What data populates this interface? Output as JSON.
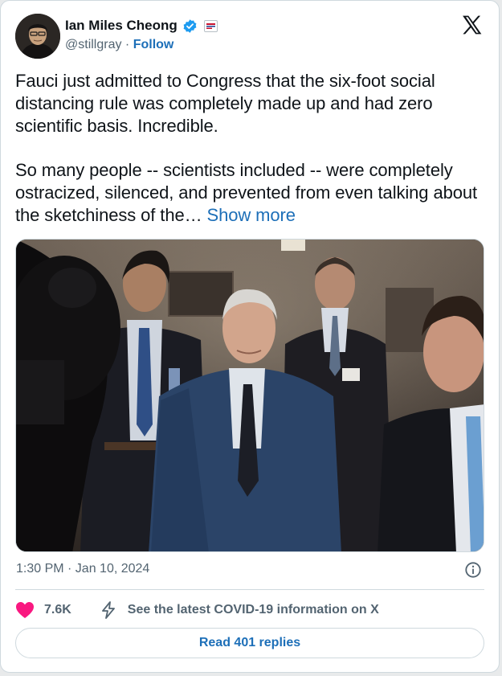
{
  "author": {
    "display_name": "Ian Miles Cheong",
    "handle": "@stillgray",
    "separator": " · ",
    "follow_label": "Follow",
    "verified_icon": "verified-badge-icon",
    "affiliation_icon": "affiliation-badge-icon"
  },
  "platform": {
    "logo_icon": "x-logo-icon"
  },
  "tweet": {
    "paragraph_1": "Fauci just admitted to Congress that the six-foot social distancing rule was completely made up and had zero scientific basis. Incredible.",
    "paragraph_2": "So many people -- scientists included -- were completely ostracized, silenced, and prevented from even talking about the sketchiness of the… ",
    "show_more_label": "Show more",
    "timestamp": "1:30 PM · Jan 10, 2024"
  },
  "engagement": {
    "like_count": "7.6K",
    "covid_info_label": "See the latest COVID-19 information on X",
    "read_replies_label": "Read 401 replies"
  },
  "colors": {
    "link_blue": "#1d6fb8",
    "like_red": "#f91880",
    "muted_text": "#536471",
    "border": "#cfd9de"
  }
}
